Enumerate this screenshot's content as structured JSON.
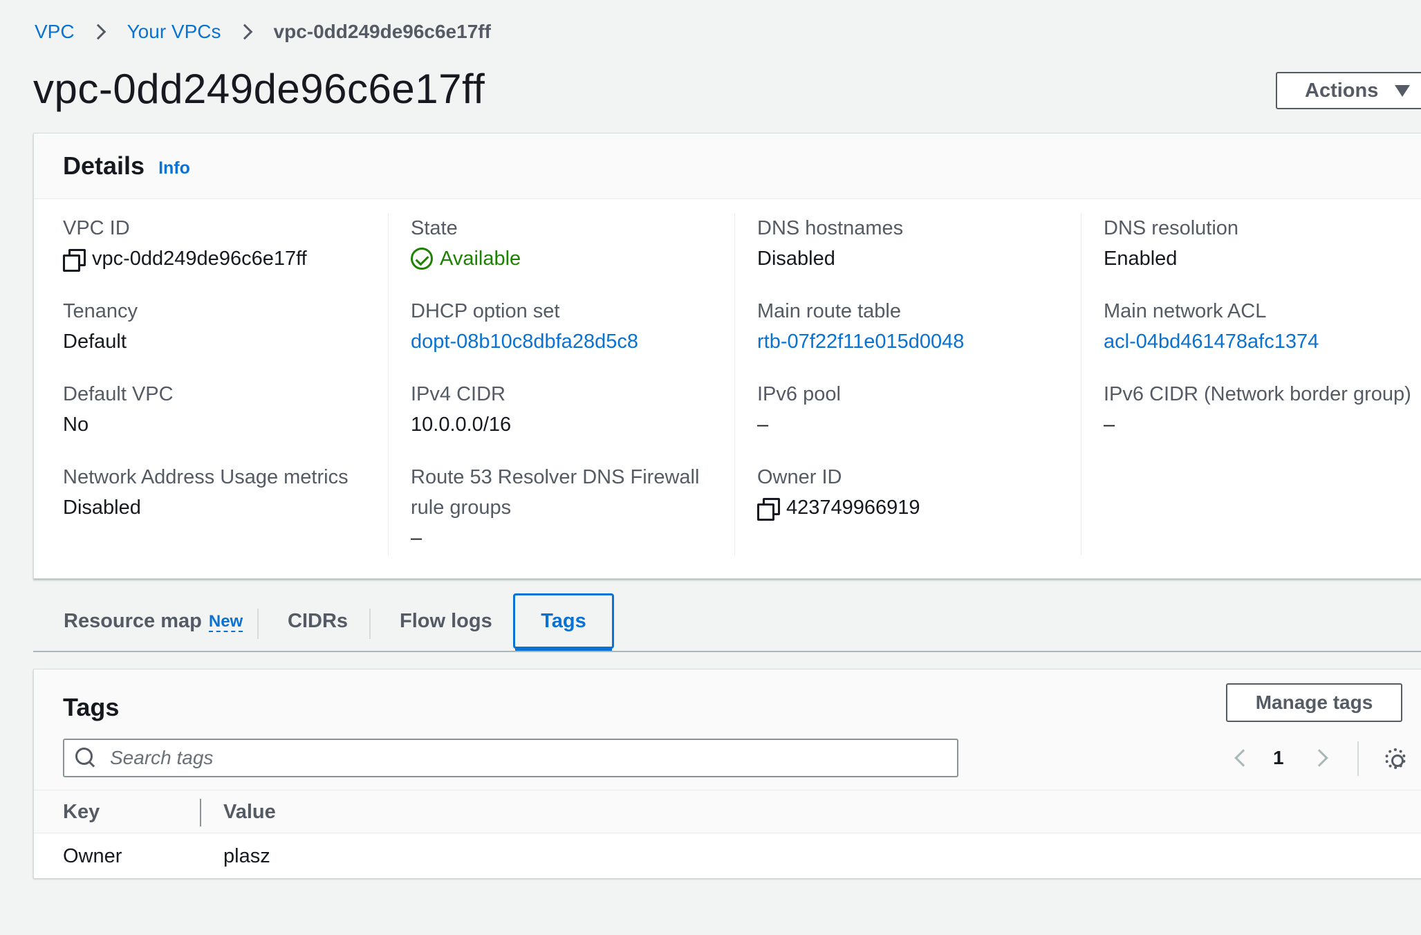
{
  "breadcrumb": {
    "items": [
      "VPC",
      "Your VPCs"
    ],
    "current": "vpc-0dd249de96c6e17ff"
  },
  "page": {
    "title": "vpc-0dd249de96c6e17ff",
    "actions_label": "Actions"
  },
  "details": {
    "title": "Details",
    "info_label": "Info",
    "vpc_id": {
      "label": "VPC ID",
      "value": "vpc-0dd249de96c6e17ff"
    },
    "state": {
      "label": "State",
      "value": "Available"
    },
    "dns_hostnames": {
      "label": "DNS hostnames",
      "value": "Disabled"
    },
    "dns_resolution": {
      "label": "DNS resolution",
      "value": "Enabled"
    },
    "tenancy": {
      "label": "Tenancy",
      "value": "Default"
    },
    "dhcp_option_set": {
      "label": "DHCP option set",
      "value": "dopt-08b10c8dbfa28d5c8"
    },
    "main_route_table": {
      "label": "Main route table",
      "value": "rtb-07f22f11e015d0048"
    },
    "main_network_acl": {
      "label": "Main network ACL",
      "value": "acl-04bd461478afc1374"
    },
    "default_vpc": {
      "label": "Default VPC",
      "value": "No"
    },
    "ipv4_cidr": {
      "label": "IPv4 CIDR",
      "value": "10.0.0.0/16"
    },
    "ipv6_pool": {
      "label": "IPv6 pool",
      "value": "–"
    },
    "ipv6_cidr": {
      "label": "IPv6 CIDR (Network border group)",
      "value": "–"
    },
    "nau_metrics": {
      "label": "Network Address Usage metrics",
      "value": "Disabled"
    },
    "route53": {
      "label_line1": "Route 53 Resolver DNS Firewall",
      "label_line2": "rule groups",
      "value": "–"
    },
    "owner_id": {
      "label": "Owner ID",
      "value": "423749966919"
    }
  },
  "tabs": [
    {
      "label": "Resource map",
      "badge": "New"
    },
    {
      "label": "CIDRs"
    },
    {
      "label": "Flow logs"
    },
    {
      "label": "Tags",
      "active": true
    }
  ],
  "tags": {
    "title": "Tags",
    "manage_label": "Manage tags",
    "search_placeholder": "Search tags",
    "page": "1",
    "columns": [
      "Key",
      "Value"
    ],
    "rows": [
      {
        "key": "Owner",
        "value": "plasz"
      }
    ]
  },
  "colors": {
    "link": "#0972d3",
    "success": "#1d8102",
    "background": "#f2f3f3"
  }
}
